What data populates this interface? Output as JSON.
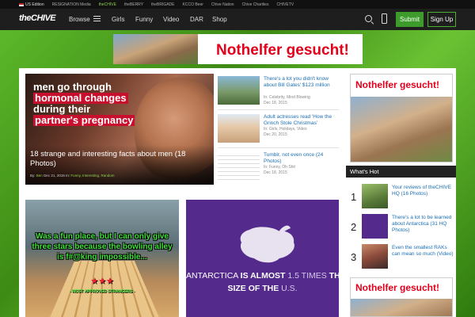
{
  "network_bar": {
    "edition": "US Edition",
    "links": [
      "RESIGNATION Media",
      "theCHIVE",
      "theBERRY",
      "theBRIGADE",
      "KCCO Beer",
      "Chive Nation",
      "Chive Charities",
      "CHIVETV"
    ]
  },
  "nav": {
    "logo_main": "theCHIVE",
    "browse": "Browse",
    "links": [
      "Girls",
      "Funny",
      "Video",
      "DAR",
      "Shop"
    ],
    "submit": "Submit",
    "signup": "Sign Up"
  },
  "top_ad": {
    "text": "Nothelfer gesucht!"
  },
  "hero": {
    "image_lines": [
      "men go through",
      "hormonal changes",
      "during their",
      "partner's pregnancy"
    ],
    "title": "18 strange and interesting facts about men (18 Photos)",
    "meta_by": "By:",
    "meta_author": "Ben",
    "meta_date": "Dec 21, 2015 In:",
    "meta_cats": "Funny, Interesting, Random"
  },
  "side_items": [
    {
      "title": "There's a lot you didn't know about Bill Gates' $123 million",
      "cat_label": "In:",
      "cats": "Celebrity, Mind Blowing",
      "date": "Dec 18, 2015"
    },
    {
      "title": "Adult actresses read 'How the Grinch Stole Christmas'",
      "cat_label": "In:",
      "cats": "Girls, Holidays, Video",
      "date": "Dec 20, 2015"
    },
    {
      "title": "Tumblr, not even once (24 Photos)",
      "cat_label": "In:",
      "cats": "Funny, Oh Shit",
      "date": "Dec 18, 2015"
    }
  ],
  "tile_bowling": {
    "quote": "Was a fun place, but I can only give three stars because the bowling alley is f#@king impossible...",
    "stars": "★★★",
    "signature": "- MOST APPROVED STRANGERS -"
  },
  "tile_antarctica": {
    "p1": "ANTARCTICA ",
    "p2": "IS ALMOST ",
    "p3": "1.5 TIMES ",
    "p4": "THE",
    "p5": "SIZE OF THE ",
    "p6": "U.S."
  },
  "right_ad": {
    "text": "Nothelfer gesucht!"
  },
  "whats_hot": {
    "title": "What's Hot",
    "items": [
      {
        "num": "1",
        "title": "Your reviews of theCHIVE HQ (16 Photos)"
      },
      {
        "num": "2",
        "title": "There's a lot to be learned about Antarctica (31 HQ Photos)"
      },
      {
        "num": "3",
        "title": "Even the smallest RAKs can mean so much (Video)"
      }
    ]
  },
  "right_ad2": {
    "text": "Nothelfer gesucht!"
  }
}
